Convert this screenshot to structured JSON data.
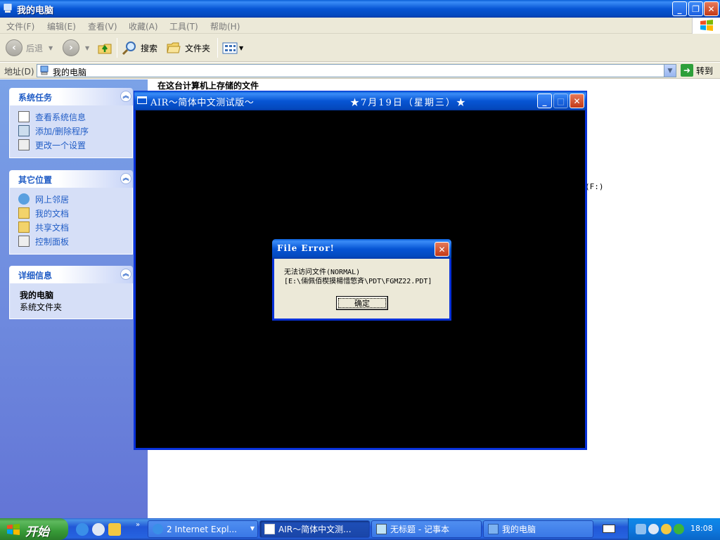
{
  "explorer": {
    "title": "我的电脑",
    "menus": [
      "文件(F)",
      "编辑(E)",
      "查看(V)",
      "收藏(A)",
      "工具(T)",
      "帮助(H)"
    ],
    "toolbar": {
      "back": "后退",
      "search": "搜索",
      "folders": "文件夹"
    },
    "address": {
      "label": "地址(D)",
      "value": "我的电脑",
      "go": "转到"
    },
    "panels": {
      "system_tasks": {
        "title": "系统任务",
        "items": [
          "查看系统信息",
          "添加/删除程序",
          "更改一个设置"
        ]
      },
      "other_places": {
        "title": "其它位置",
        "items": [
          "网上邻居",
          "我的文档",
          "共享文档",
          "控制面板"
        ]
      },
      "details": {
        "title": "详细信息",
        "name": "我的电脑",
        "desc": "系统文件夹"
      }
    },
    "content": {
      "heading": "在这台计算机上存储的文件",
      "partial_drive_text": "(F:)"
    }
  },
  "air_window": {
    "title": "AIR～简体中文测试版～",
    "date": "★7月19日（星期三）★"
  },
  "error_dialog": {
    "title": "File Error!",
    "message_line1": "无法访问文件(NORMAL)",
    "message_line2": "[E:\\倆佩佰楔摸楊惜憼斉\\PDT\\FGMZ22.PDT]",
    "ok": "确定"
  },
  "taskbar": {
    "start": "开始",
    "buttons": [
      "2 Internet Expl...",
      "AIR～简体中文测...",
      "无标题 - 记事本",
      "我的电脑"
    ],
    "clock": "18:08"
  },
  "colors": {
    "xp_blue": "#0755d4",
    "task_link": "#215dc6",
    "start_green": "#379a37"
  }
}
